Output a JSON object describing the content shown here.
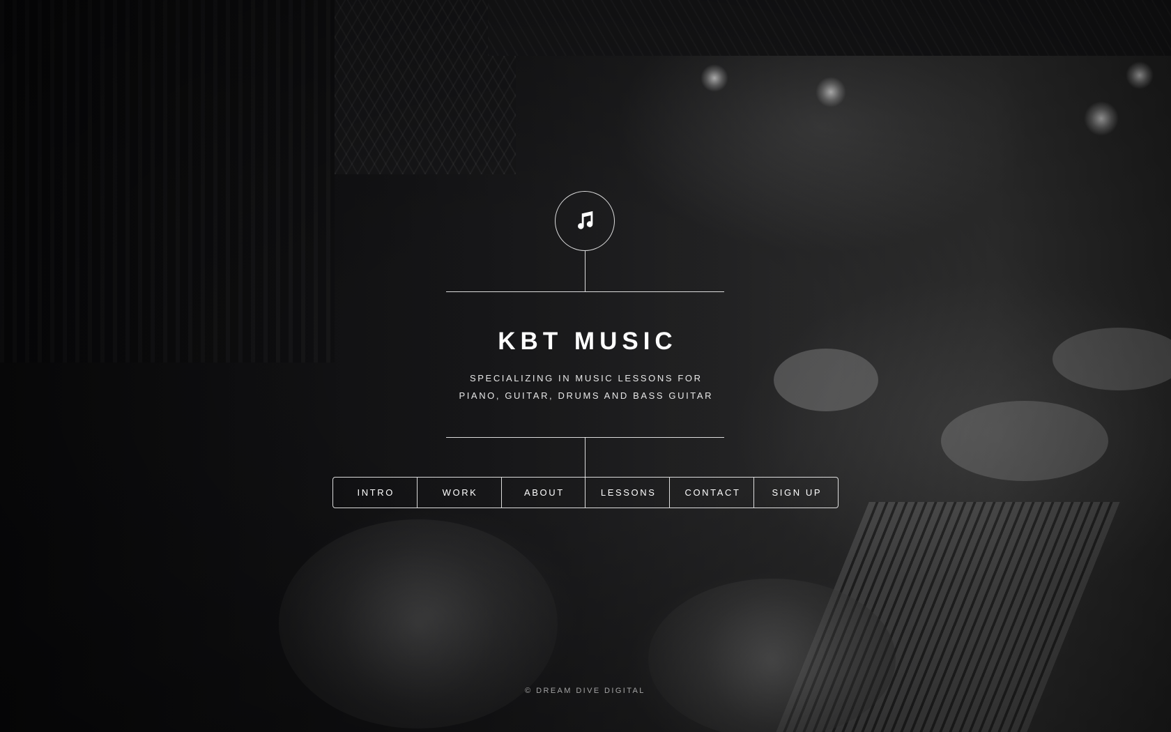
{
  "site": {
    "title": "KBT MUSIC",
    "tagline_line1": "SPECIALIZING IN MUSIC LESSONS FOR",
    "tagline_line2": "PIANO, GUITAR, DRUMS AND BASS GUITAR",
    "logo_icon": "music-note-icon"
  },
  "nav": {
    "items": [
      {
        "label": "INTRO"
      },
      {
        "label": "WORK"
      },
      {
        "label": "ABOUT"
      },
      {
        "label": "LESSONS"
      },
      {
        "label": "CONTACT"
      },
      {
        "label": "SIGN UP"
      }
    ]
  },
  "footer": {
    "copyright": "© DREAM DIVE DIGITAL"
  },
  "colors": {
    "foreground": "#ffffff",
    "background_overlay": "#0d0d0f"
  }
}
